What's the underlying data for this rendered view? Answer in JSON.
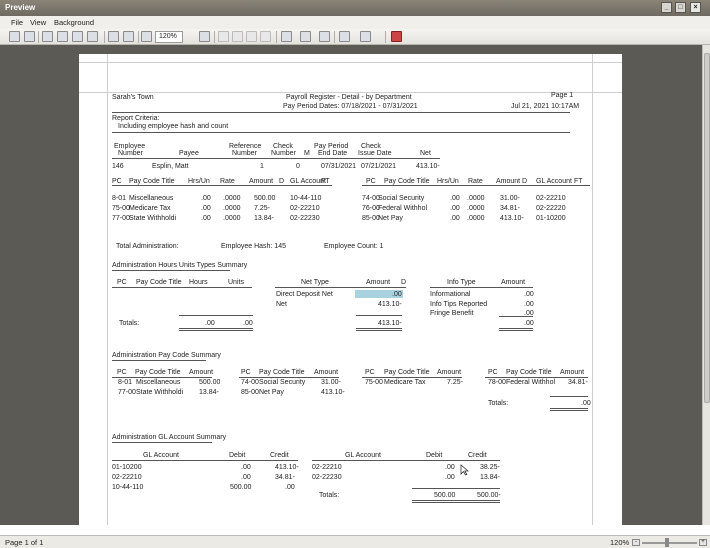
{
  "window": {
    "title": "Preview"
  },
  "menu": [
    "File",
    "View",
    "Background"
  ],
  "toolbar": {
    "zoom": "120%"
  },
  "status": {
    "page": "Page 1 of 1",
    "zoom": "120%"
  },
  "report": {
    "org": "Sarah's Town",
    "title": "Payroll Register - Detail - by Department",
    "period": "Pay Period Dates: 07/18/2021 - 07/31/2021",
    "page": "Page 1",
    "datetime": "Jul 21, 2021 10:17AM",
    "criteria_label": "Report Criteria:",
    "criteria": "Including employee hash and count",
    "emp_headers": [
      "Employee",
      "Number",
      "Payee",
      "Reference",
      "Number",
      "Check",
      "Number",
      "M",
      "Pay Period",
      "End Date",
      "Check",
      "Issue Date",
      "Net"
    ],
    "emp_row": [
      "146",
      "Esplin, Matt",
      "1",
      "0",
      "07/31/2021",
      "07/21/2021",
      "413.10-"
    ],
    "pc_headers": [
      "PC",
      "Pay Code Title",
      "Hrs/Un",
      "Rate",
      "Amount",
      "D",
      "GL Account",
      "FT"
    ],
    "pc_left": [
      [
        "8-01",
        "Miscellaneous",
        ".00",
        ".0000",
        "500.00",
        "",
        "10-44-110"
      ],
      [
        "75-00",
        "Medicare Tax",
        ".00",
        ".0000",
        "7.25-",
        "",
        "02-22210"
      ],
      [
        "77-00",
        "State Withholdi",
        ".00",
        ".0000",
        "13.84-",
        "",
        "02-22230"
      ]
    ],
    "pc_right": [
      [
        "74-00",
        "Social Security",
        ".00",
        ".0000",
        "31.00-",
        "",
        "02-22210"
      ],
      [
        "76-00",
        "Federal Withhol",
        ".00",
        ".0000",
        "34.81-",
        "",
        "02-22220"
      ],
      [
        "85-00",
        "Net Pay",
        ".00",
        ".0000",
        "413.10-",
        "",
        "01-10200"
      ]
    ],
    "totals": {
      "admin": "Total Administration:",
      "hash": "Employee Hash:  145",
      "count": "Employee Count:  1"
    },
    "hrs": {
      "title": "Administration Hours Units Types Summary",
      "headers": [
        "PC",
        "Pay Code Title",
        "Hours",
        "Units"
      ],
      "totals_label": "Totals:",
      "hours_total": ".00",
      "units_total": ".00"
    },
    "net": {
      "headers": [
        "Net Type",
        "Amount",
        "D"
      ],
      "rows": [
        [
          "Direct Deposit Net",
          ".00"
        ],
        [
          "Net",
          "413.10-"
        ]
      ],
      "total": "413.10-"
    },
    "info": {
      "headers": [
        "Info Type",
        "Amount"
      ],
      "rows": [
        [
          "Informational",
          ".00"
        ],
        [
          "Info Tips Reported",
          ".00"
        ],
        [
          "Fringe Benefit",
          ".00"
        ]
      ],
      "total": ".00"
    },
    "paysum": {
      "title": "Administration Pay Code Summary",
      "headers": [
        "PC",
        "Pay Code Title",
        "Amount"
      ],
      "col1": [
        [
          "8-01",
          "Miscellaneous",
          "500.00"
        ],
        [
          "77-00",
          "State Withholdi",
          "13.84-"
        ]
      ],
      "col2": [
        [
          "74-00",
          "Social Security",
          "31.00-"
        ],
        [
          "85-00",
          "Net Pay",
          "413.10-"
        ]
      ],
      "col3": [
        [
          "75-00",
          "Medicare Tax",
          "7.25-"
        ]
      ],
      "col4": [
        [
          "78-00",
          "Federal Withhol",
          "34.81-"
        ]
      ],
      "totals_label": "Totals:",
      "total": ".00"
    },
    "glsum": {
      "title": "Administration GL Account Summary",
      "headers": [
        "GL Account",
        "Debit",
        "Credit"
      ],
      "left": [
        [
          "01-10200",
          ".00",
          "413.10-"
        ],
        [
          "02-22210",
          ".00",
          "34.81-"
        ],
        [
          "10-44-110",
          "500.00",
          ".00"
        ]
      ],
      "right": [
        [
          "02-22210",
          ".00",
          "38.25-"
        ],
        [
          "02-22230",
          ".00",
          "13.84-"
        ]
      ],
      "totals_label": "Totals:",
      "debit_total": "500.00",
      "credit_total": "500.00-"
    }
  }
}
